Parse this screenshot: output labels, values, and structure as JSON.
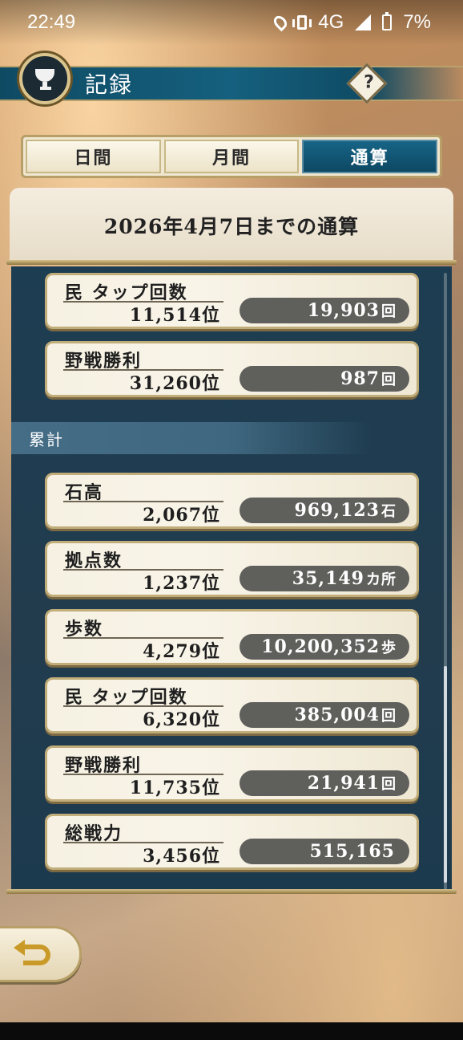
{
  "status_bar": {
    "time": "22:49",
    "network": "4G",
    "battery": "7%"
  },
  "header": {
    "title": "記録",
    "help": "?"
  },
  "tabs": [
    {
      "label": "日間",
      "active": false
    },
    {
      "label": "月間",
      "active": false
    },
    {
      "label": "通算",
      "active": true
    }
  ],
  "panel": {
    "heading": "2026年4月7日までの通算",
    "top_cards": [
      {
        "label": "民 タップ回数",
        "rank": "11,514位",
        "value": "19,903",
        "unit": "回"
      },
      {
        "label": "野戦勝利",
        "rank": "31,260位",
        "value": "987",
        "unit": "回"
      }
    ],
    "section_label": "累計",
    "cumulative_cards": [
      {
        "label": "石高",
        "rank": "2,067位",
        "value": "969,123",
        "unit": "石"
      },
      {
        "label": "拠点数",
        "rank": "1,237位",
        "value": "35,149",
        "unit": "カ所"
      },
      {
        "label": "歩数",
        "rank": "4,279位",
        "value": "10,200,352",
        "unit": "歩"
      },
      {
        "label": "民 タップ回数",
        "rank": "6,320位",
        "value": "385,004",
        "unit": "回"
      },
      {
        "label": "野戦勝利",
        "rank": "11,735位",
        "value": "21,941",
        "unit": "回"
      },
      {
        "label": "総戦力",
        "rank": "3,456位",
        "value": "515,165",
        "unit": ""
      }
    ]
  },
  "icons": {
    "header": "trophy-icon",
    "help": "help-icon",
    "back": "back-arrow-icon"
  }
}
